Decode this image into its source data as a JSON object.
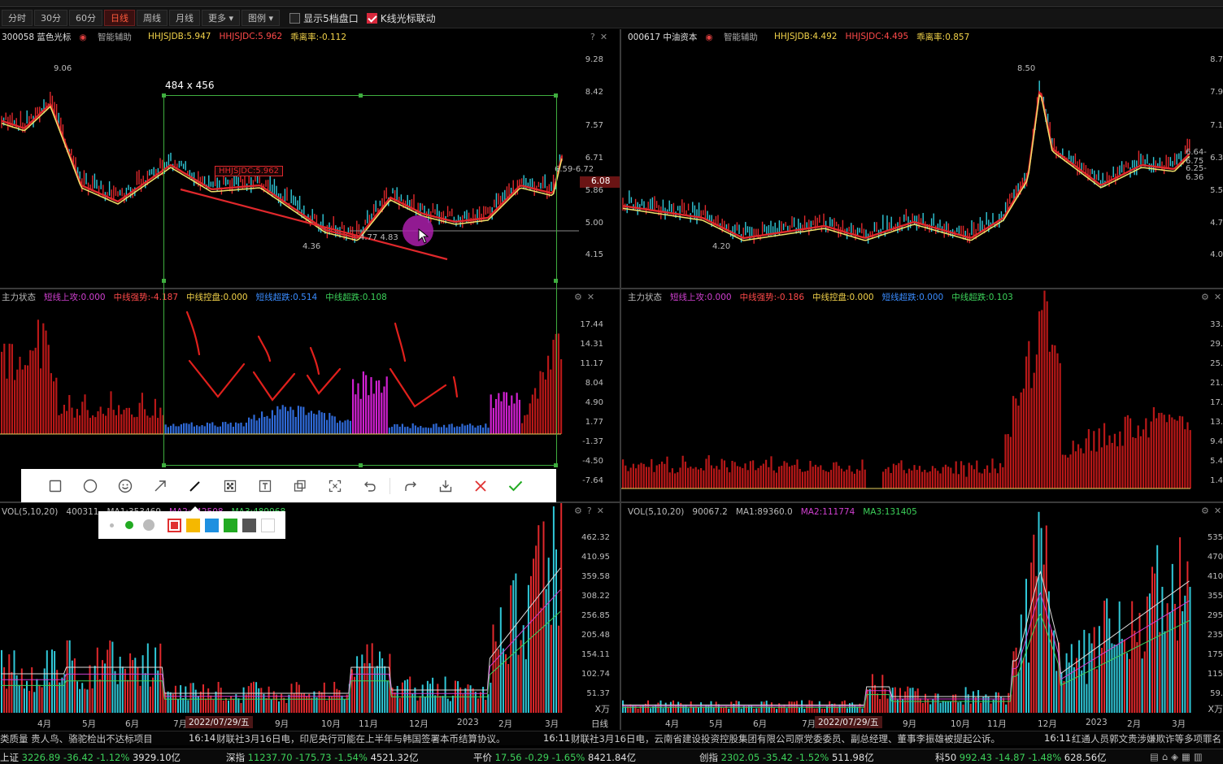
{
  "toolbar": {
    "periods": [
      "分时",
      "30分",
      "60分",
      "日线",
      "周线",
      "月线",
      "更多"
    ],
    "active_period": "日线",
    "legend_label": "图例",
    "show5_label": "显示5档盘口",
    "klink_label": "K线光标联动"
  },
  "left": {
    "kline": {
      "code_name": "300058 蓝色光标",
      "assist": "智能辅助",
      "hhjsjdb": "HHJSJDB:5.947",
      "hhjsjdc": "HHJSJDC:5.962",
      "deviation": "乖离率:-0.112",
      "yticks": [
        "9.28",
        "8.42",
        "7.57",
        "6.71",
        "5.86",
        "5.00",
        "4.15"
      ],
      "current_price": "6.08",
      "price_tag": "6.59-6.72",
      "high_label": "9.06",
      "low_label": "4.36",
      "low_label2": "4.77 4.83",
      "overlay_label": "HHJSJDC:5.962"
    },
    "zhuli": {
      "name": "主力状态",
      "a": "短线上攻:0.000",
      "b": "中线强势:-4.187",
      "c": "中线控盘:0.000",
      "d": "短线超跌:0.514",
      "e": "中线超跌:0.108",
      "yticks": [
        "17.44",
        "14.31",
        "11.17",
        "8.04",
        "4.90",
        "1.77",
        "-1.37",
        "-4.50",
        "-7.64"
      ]
    },
    "vol": {
      "name": "VOL(5,10,20)",
      "value": "400311",
      "ma1": "MA1:353469",
      "ma2": "MA2:442508",
      "ma3": "MA3:489968",
      "yticks": [
        "462.32",
        "410.95",
        "359.58",
        "308.22",
        "256.85",
        "205.48",
        "154.11",
        "102.74",
        "51.37"
      ],
      "unit": "X万"
    },
    "xaxis": [
      "4月",
      "5月",
      "6月",
      "7月",
      "9月",
      "10月",
      "11月",
      "12月",
      "2023",
      "2月",
      "3月"
    ],
    "date_badge": "2022/07/29/五",
    "period_label": "日线"
  },
  "right": {
    "kline": {
      "code_name": "000617 中油资本",
      "assist": "智能辅助",
      "hhjsjdb": "HHJSJDB:4.492",
      "hhjsjdc": "HHJSJDC:4.495",
      "deviation": "乖离率:0.857",
      "yticks": [
        "8.7",
        "7.9",
        "7.1",
        "6.3",
        "5.5",
        "4.7",
        "4.0"
      ],
      "high_label": "8.50",
      "low_label": "4.20",
      "price_tag1": "6.64-6.75",
      "price_tag2": "6.25-6.36"
    },
    "zhuli": {
      "name": "主力状态",
      "a": "短线上攻:0.000",
      "b": "中线强势:-0.186",
      "c": "中线控盘:0.000",
      "d": "短线超跌:0.000",
      "e": "中线超跌:0.103",
      "yticks": [
        "33.",
        "29.",
        "25.",
        "21.",
        "17.",
        "13.",
        "9.4",
        "5.4",
        "1.4"
      ]
    },
    "vol": {
      "name": "VOL(5,10,20)",
      "value": "90067.2",
      "ma1": "MA1:89360.0",
      "ma2": "MA2:111774",
      "ma3": "MA3:131405",
      "yticks": [
        "535",
        "470",
        "410",
        "355",
        "295",
        "235",
        "175",
        "115",
        "59."
      ],
      "unit": "X万"
    },
    "xaxis": [
      "4月",
      "5月",
      "6月",
      "7月",
      "9月",
      "10月",
      "11月",
      "12月",
      "2023",
      "2月",
      "3月"
    ],
    "date_badge": "2022/07/29/五"
  },
  "selection": {
    "size_label": "484 x 456"
  },
  "draw_tools": [
    "rect",
    "circle",
    "emoji",
    "arrow",
    "pen",
    "mosaic",
    "text",
    "copy",
    "ocr",
    "undo",
    "redo",
    "save",
    "cancel",
    "done"
  ],
  "draw_tool_icons": [
    "rect-icon",
    "circle-icon",
    "emoji-icon",
    "arrow-icon",
    "pen-icon",
    "mosaic-icon",
    "text-icon",
    "copy-icon",
    "ocr-icon",
    "undo-icon",
    "redo-icon",
    "save-icon",
    "cancel-icon",
    "confirm-icon"
  ],
  "palette": {
    "colors": [
      "#e03030",
      "#f5b800",
      "#1e90e0",
      "#22aa22",
      "#555555",
      "#ffffff"
    ]
  },
  "ticker": {
    "t1": "类质量 贵人鸟、骆驼检出不达标项目",
    "t2_time": "16:14",
    "t2": "财联社3月16日电，印尼央行可能在上半年与韩国签署本币结算协议。",
    "t3_time": "16:11",
    "t3": "财联社3月16日电，云南省建设投资控股集团有限公司原党委委员、副总经理、董事李振雄被提起公诉。",
    "t4_time": "16:11",
    "t4": "红通人员郭文贵涉嫌欺诈等多项罪名"
  },
  "status": {
    "sh_label": "上证",
    "sh_val": "3226.89",
    "sh_chg": "-36.42",
    "sh_pct": "-1.12%",
    "sh_amt": "3929.10亿",
    "sz_label": "深指",
    "sz_val": "11237.70",
    "sz_chg": "-175.73",
    "sz_pct": "-1.54%",
    "sz_amt": "4521.32亿",
    "avg_label": "平价",
    "avg_val": "17.56",
    "avg_chg": "-0.29",
    "avg_pct": "-1.65%",
    "avg_amt": "8421.84亿",
    "cy_label": "创指",
    "cy_val": "2302.05",
    "cy_chg": "-35.42",
    "cy_pct": "-1.52%",
    "cy_amt": "511.98亿",
    "kc_label": "科50",
    "kc_val": "992.43",
    "kc_chg": "-14.87",
    "kc_pct": "-1.48%",
    "kc_amt": "628.56亿"
  }
}
